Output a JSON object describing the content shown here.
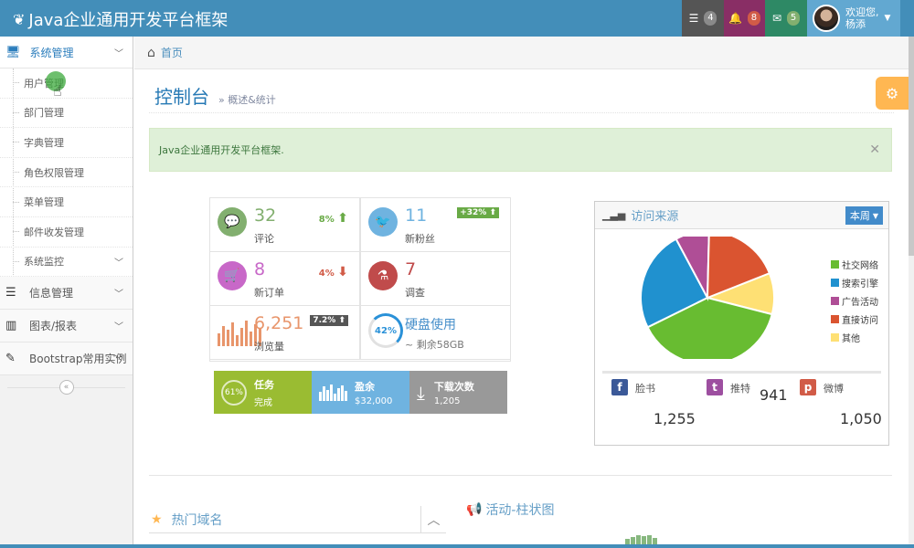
{
  "navbar": {
    "brand": "Java企业通用开发平台框架",
    "tasks_count": "4",
    "notifications_count": "8",
    "messages_count": "5",
    "welcome": "欢迎您,",
    "username": "杨添"
  },
  "sidebar": {
    "system_menu": "系统管理",
    "sub_items": [
      "用户管理",
      "部门管理",
      "字典管理",
      "角色权限管理",
      "菜单管理",
      "邮件收发管理",
      "系统监控"
    ],
    "menus": [
      "信息管理",
      "图表/报表",
      "Bootstrap常用实例"
    ]
  },
  "breadcrumb": {
    "home": "首页"
  },
  "header": {
    "title": "控制台",
    "subtitle": "概述&统计"
  },
  "alert": {
    "text": "Java企业通用开发平台框架."
  },
  "stats": {
    "comments": {
      "num": "32",
      "label": "评论",
      "pct": "8%"
    },
    "followers": {
      "num": "11",
      "label": "新粉丝",
      "pct": "+32%"
    },
    "orders": {
      "num": "8",
      "label": "新订单",
      "pct": "4%"
    },
    "surveys": {
      "num": "7",
      "label": "调查"
    },
    "pageviews": {
      "num": "6,251",
      "label": "浏览量",
      "pct": "7.2%"
    },
    "disk": {
      "pct": "42%",
      "title": "硬盘使用",
      "remaining": "~ 剩余58GB"
    }
  },
  "infoboxes": {
    "task": {
      "pct": "61%",
      "title": "任务",
      "sub": "完成"
    },
    "balance": {
      "title": "盈余",
      "sub": "$32,000"
    },
    "downloads": {
      "title": "下载次数",
      "sub": "1,205"
    }
  },
  "traffic": {
    "title": "访问来源",
    "period": "本周",
    "legend": [
      "社交网络",
      "搜索引擎",
      "广告活动",
      "直接访问",
      "其他"
    ],
    "colors": [
      "#68bc31",
      "#2091cf",
      "#af4e96",
      "#da5430",
      "#fee074"
    ],
    "shares": [
      38.7,
      24.5,
      8.2,
      18.6,
      10
    ],
    "facebook_label": "脸书",
    "facebook_value": "1,255",
    "twitter_label": "推特",
    "twitter_value": "941",
    "weibo_label": "微博",
    "weibo_value": "1,050"
  },
  "hot_domains": {
    "title": "热门域名"
  },
  "activity": {
    "title": "活动-柱状图"
  }
}
